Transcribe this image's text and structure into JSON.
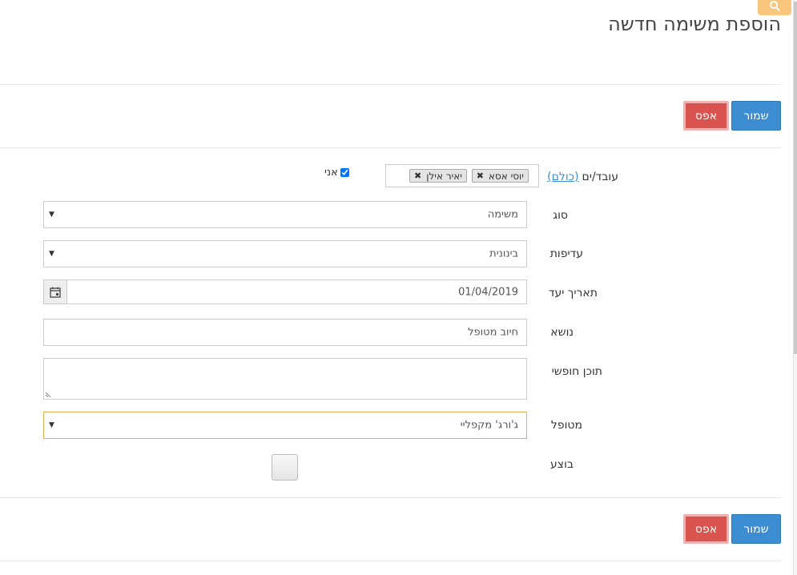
{
  "page": {
    "title": "הוספת משימה חדשה"
  },
  "toolbar_top": {
    "save_label": "שמור",
    "reset_label": "אפס"
  },
  "toolbar_bottom": {
    "save_label": "שמור",
    "reset_label": "אפס"
  },
  "form": {
    "workers": {
      "label": "עובד/ים",
      "all_link": "(כולם)",
      "tags": [
        "יוסי אסא",
        "יאיר אילן"
      ],
      "me_label": "אני",
      "me_checked": true
    },
    "type": {
      "label": "סוג",
      "value": "משימה"
    },
    "priority": {
      "label": "עדיפות",
      "value": "בינונית"
    },
    "due_date": {
      "label": "תאריך יעד",
      "value": "01/04/2019"
    },
    "subject": {
      "label": "נושא",
      "value": "חיוב מטופל"
    },
    "free_text": {
      "label": "תוכן חופשי",
      "value": ""
    },
    "patient": {
      "label": "מטופל",
      "value": "ג'ורג' מקפליי"
    },
    "done": {
      "label": "בוצע",
      "checked": false
    }
  },
  "colors": {
    "primary": "#3c8dd2",
    "danger": "#d9534f",
    "focus": "#f0ad4e"
  }
}
